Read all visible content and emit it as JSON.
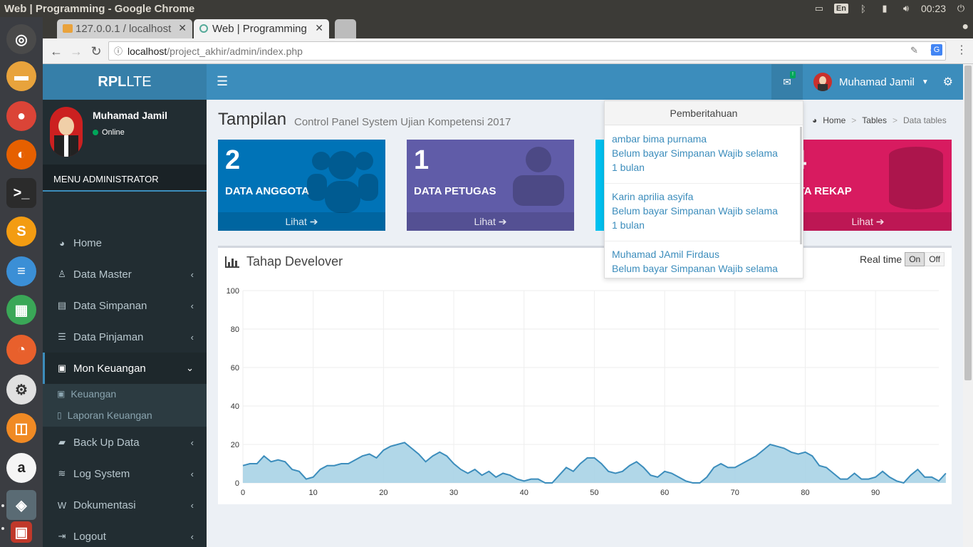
{
  "os": {
    "window_title": "Web | Programming - Google Chrome",
    "keyboard": "En",
    "clock": "00:23"
  },
  "browser": {
    "tabs": [
      {
        "label": "127.0.0.1 / localhost"
      },
      {
        "label": "Web | Programming"
      }
    ],
    "url_host": "localhost",
    "url_path": "/project_akhir/admin/index.php"
  },
  "app": {
    "logo_bold": "RPL",
    "logo_rest": "LTE",
    "user_name": "Muhamad Jamil",
    "user_status": "Online",
    "menu_header": "MENU ADMINISTRATOR",
    "menu": [
      {
        "label": "Home",
        "icon": "dashboard-icon"
      },
      {
        "label": "Data Master",
        "icon": "male-icon"
      },
      {
        "label": "Data Simpanan",
        "icon": "newspaper-icon"
      },
      {
        "label": "Data Pinjaman",
        "icon": "list-icon"
      },
      {
        "label": "Mon Keuangan",
        "icon": "money-icon"
      },
      {
        "label": "Back Up Data",
        "icon": "briefcase-icon"
      },
      {
        "label": "Log System",
        "icon": "database-icon"
      },
      {
        "label": "Dokumentasi",
        "icon": "word-file-icon"
      },
      {
        "label": "Logout",
        "icon": "sign-out-icon"
      }
    ],
    "submenu": [
      {
        "label": "Keuangan"
      },
      {
        "label": "Laporan Keuangan"
      }
    ]
  },
  "content": {
    "title": "Tampilan",
    "subtitle": "Control Panel System Ujian Kompetensi 2017",
    "breadcrumb": [
      "Home",
      "Tables",
      "Data tables"
    ],
    "boxes": [
      {
        "number": "2",
        "label": "DATA ANGGOTA",
        "footer": "Lihat",
        "color": "#0073b7"
      },
      {
        "number": "1",
        "label": "DATA PETUGAS",
        "footer": "Lihat",
        "color": "#605ca8"
      },
      {
        "number": "",
        "label": "",
        "footer": "",
        "color": "#00c0ef"
      },
      {
        "number": "4",
        "label": "ATA REKAP",
        "footer": "Lihat",
        "color": "#d81b60"
      }
    ],
    "chart_box_title": "Tahap Develover",
    "realtime_label": "Real time",
    "realtime_on": "On",
    "realtime_off": "Off"
  },
  "notifications": {
    "header": "Pemberitahuan",
    "items": [
      {
        "name": "ambar bima purnama",
        "msg": "Belum bayar Simpanan Wajib selama",
        "period": "1 bulan"
      },
      {
        "name": "Karin aprilia asyifa",
        "msg": "Belum bayar Simpanan Wajib selama",
        "period": "1 bulan"
      },
      {
        "name": "Muhamad JAmil Firdaus",
        "msg": "Belum bayar Simpanan Wajib selama",
        "period": ""
      }
    ]
  },
  "chart_data": {
    "type": "area",
    "title": "",
    "xlabel": "",
    "ylabel": "",
    "xlim": [
      0,
      99
    ],
    "ylim": [
      0,
      100
    ],
    "x_ticks": [
      0,
      10,
      20,
      30,
      40,
      50,
      60,
      70,
      80,
      90
    ],
    "y_ticks": [
      0,
      20,
      40,
      60,
      80,
      100
    ],
    "grid": true,
    "color": "#3c8dbc",
    "fill": "#a9d3e6",
    "values": [
      9,
      10,
      10,
      14,
      11,
      12,
      11,
      7,
      6,
      2,
      3,
      7,
      9,
      9,
      10,
      10,
      12,
      14,
      15,
      13,
      17,
      19,
      20,
      21,
      18,
      15,
      11,
      14,
      16,
      14,
      10,
      7,
      5,
      7,
      4,
      6,
      3,
      5,
      4,
      2,
      1,
      2,
      2,
      0,
      0,
      4,
      8,
      6,
      10,
      13,
      13,
      10,
      6,
      5,
      6,
      9,
      11,
      8,
      4,
      3,
      6,
      5,
      3,
      1,
      0,
      0,
      3,
      8,
      10,
      8,
      8,
      10,
      12,
      14,
      17,
      20,
      19,
      18,
      16,
      15,
      16,
      14,
      9,
      8,
      5,
      2,
      2,
      5,
      2,
      2,
      3,
      6,
      3,
      1,
      0,
      4,
      7,
      3,
      3,
      1,
      5
    ]
  }
}
